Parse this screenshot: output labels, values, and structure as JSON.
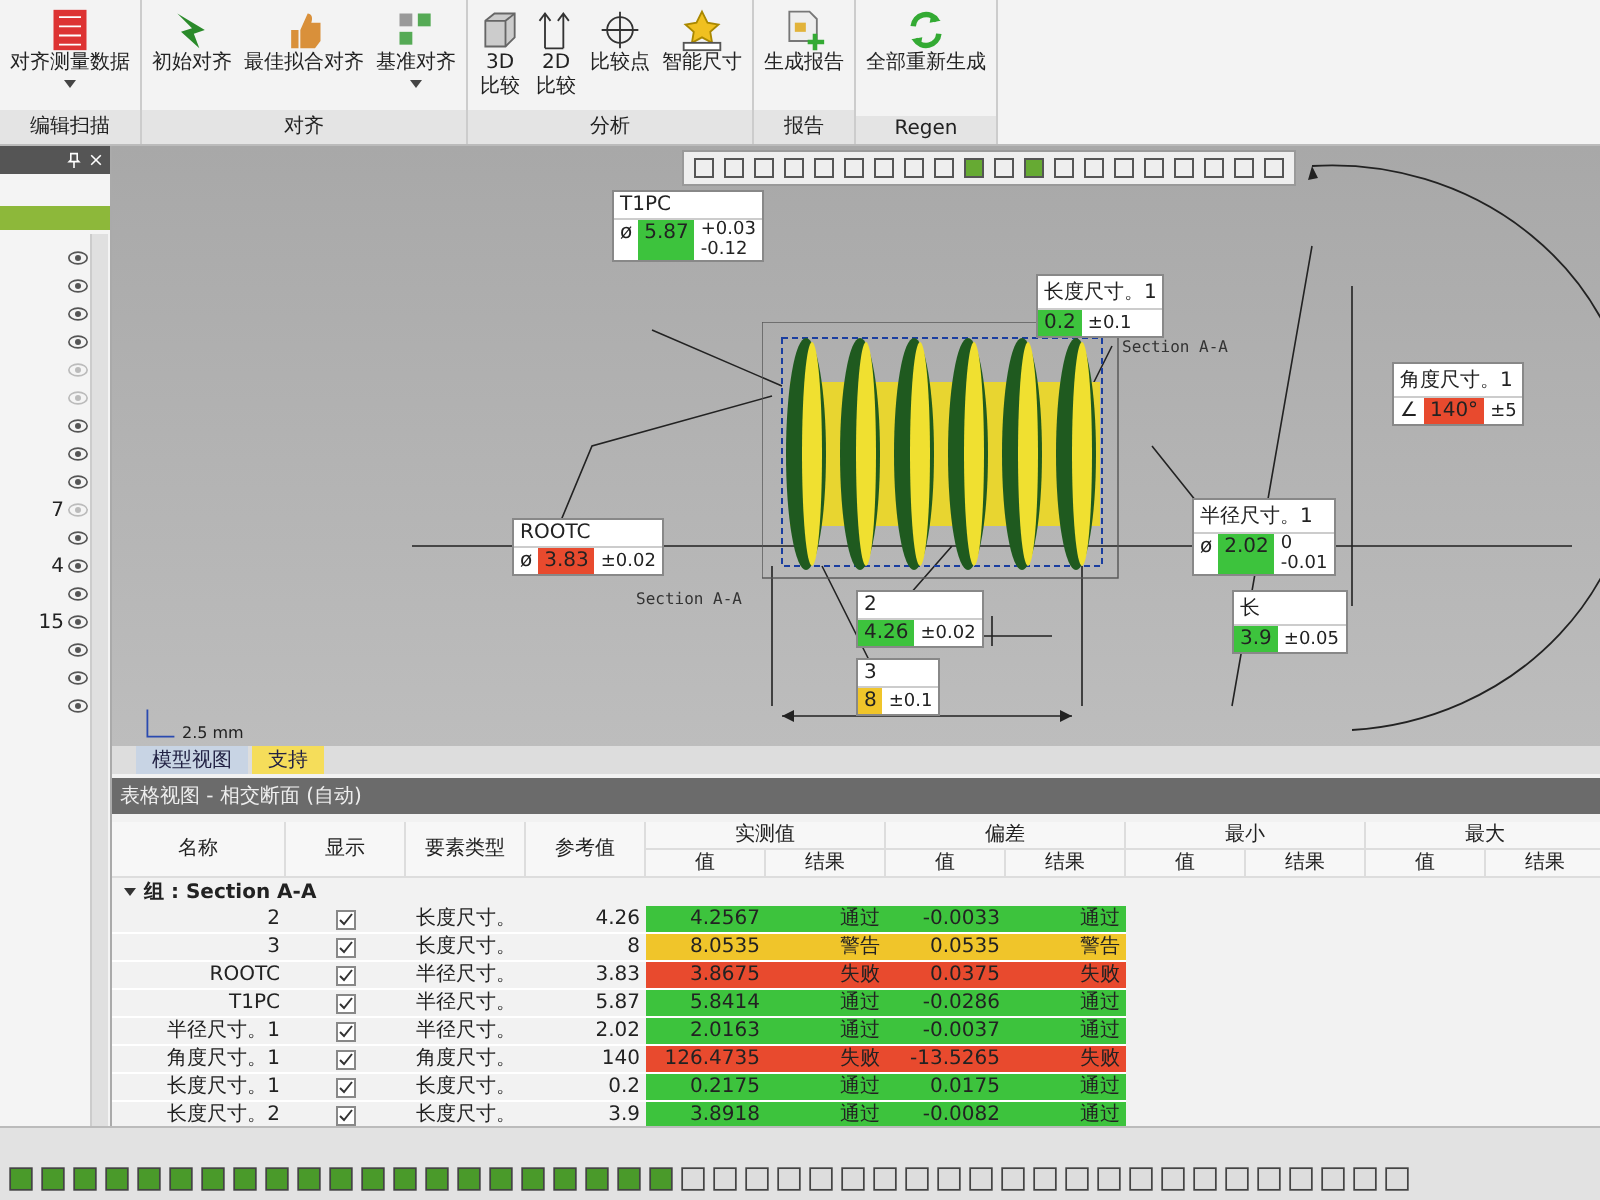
{
  "ribbon": {
    "groups": [
      {
        "label": "编辑扫描",
        "buttons": [
          {
            "label": "对齐测量数据",
            "dropdown": true
          }
        ]
      },
      {
        "label": "对齐",
        "buttons": [
          {
            "label": "初始对齐",
            "dropdown": false
          },
          {
            "label": "最佳拟合对齐",
            "dropdown": false
          },
          {
            "label": "基准对齐",
            "dropdown": true
          }
        ]
      },
      {
        "label": "分析",
        "buttons": [
          {
            "label": "3D\n比较",
            "dropdown": false
          },
          {
            "label": "2D\n比较",
            "dropdown": false
          },
          {
            "label": "比较点",
            "dropdown": false
          },
          {
            "label": "智能尺寸",
            "dropdown": false
          }
        ]
      },
      {
        "label": "报告",
        "buttons": [
          {
            "label": "生成报告",
            "dropdown": false
          }
        ]
      },
      {
        "label": "Regen",
        "buttons": [
          {
            "label": "全部重新生成",
            "dropdown": false
          }
        ]
      }
    ]
  },
  "left_panel": {
    "items": [
      {
        "visible": true
      },
      {
        "visible": true
      },
      {
        "visible": true
      },
      {
        "visible": true
      },
      {
        "visible": false
      },
      {
        "visible": false
      },
      {
        "visible": true
      },
      {
        "visible": true
      },
      {
        "visible": true
      },
      {
        "number": "7",
        "visible": false
      },
      {
        "visible": true
      },
      {
        "number": "4",
        "visible": true
      },
      {
        "visible": true
      },
      {
        "number": "15",
        "visible": true
      },
      {
        "visible": true
      },
      {
        "visible": true
      },
      {
        "visible": true
      }
    ]
  },
  "view": {
    "section_labels": [
      "Section A-A",
      "Section A-A"
    ],
    "scale": "2.5 mm",
    "annotations": [
      {
        "label": "T1PC",
        "symbol": "ø",
        "value": "5.87",
        "color": "#3dc33d",
        "tolerance": [
          "+0.03",
          "-0.12"
        ]
      },
      {
        "label": "长度尺寸。1",
        "value": "0.2",
        "color": "#3dc33d",
        "tolerance": [
          "±0.1"
        ]
      },
      {
        "label": "ROOTC",
        "symbol": "ø",
        "value": "3.83",
        "color": "#e84a2e",
        "tolerance": [
          "±0.02"
        ]
      },
      {
        "label": "2",
        "value": "4.26",
        "color": "#3dc33d",
        "tolerance": [
          "±0.02"
        ]
      },
      {
        "label": "3",
        "value": "8",
        "color": "#f0c52a",
        "tolerance": [
          "±0.1"
        ]
      },
      {
        "label": "半径尺寸。1",
        "symbol": "ø",
        "value": "2.02",
        "color": "#3dc33d",
        "tolerance": [
          "0",
          "-0.01"
        ]
      },
      {
        "label": "长",
        "value": "3.9",
        "color": "#3dc33d",
        "tolerance": [
          "±0.05"
        ]
      },
      {
        "label": "角度尺寸。1",
        "symbol": "∠",
        "value": "140°",
        "color": "#e84a2e",
        "tolerance": [
          "±5"
        ]
      }
    ]
  },
  "tabs": [
    {
      "label": "模型视图",
      "selected": false
    },
    {
      "label": "支持",
      "selected": true
    }
  ],
  "table": {
    "title": "表格视图 - 相交断面 (自动)",
    "columns": [
      "名称",
      "显示",
      "要素类型",
      "参考值"
    ],
    "column_groups": [
      {
        "label": "实测值",
        "sub": [
          "值",
          "结果"
        ]
      },
      {
        "label": "偏差",
        "sub": [
          "值",
          "结果"
        ]
      },
      {
        "label": "最小",
        "sub": [
          "值",
          "结果"
        ]
      },
      {
        "label": "最大",
        "sub": [
          "值",
          "结果"
        ]
      }
    ],
    "group": "组 : Section A-A",
    "rows": [
      {
        "name": "2",
        "shown": true,
        "type": "长度尺寸。",
        "reference": "4.26",
        "measured": "4.2567",
        "result": "通过",
        "deviation": "-0.0033",
        "deviation_result": "通过",
        "color": "#3dc33d"
      },
      {
        "name": "3",
        "shown": true,
        "type": "长度尺寸。",
        "reference": "8",
        "measured": "8.0535",
        "result": "警告",
        "deviation": "0.0535",
        "deviation_result": "警告",
        "color": "#f0c52a"
      },
      {
        "name": "ROOTC",
        "shown": true,
        "type": "半径尺寸。",
        "reference": "3.83",
        "measured": "3.8675",
        "result": "失败",
        "deviation": "0.0375",
        "deviation_result": "失败",
        "color": "#e84a2e"
      },
      {
        "name": "T1PC",
        "shown": true,
        "type": "半径尺寸。",
        "reference": "5.87",
        "measured": "5.8414",
        "result": "通过",
        "deviation": "-0.0286",
        "deviation_result": "通过",
        "color": "#3dc33d"
      },
      {
        "name": "半径尺寸。1",
        "shown": true,
        "type": "半径尺寸。",
        "reference": "2.02",
        "measured": "2.0163",
        "result": "通过",
        "deviation": "-0.0037",
        "deviation_result": "通过",
        "color": "#3dc33d"
      },
      {
        "name": "角度尺寸。1",
        "shown": true,
        "type": "角度尺寸。",
        "reference": "140",
        "measured": "126.4735",
        "result": "失败",
        "deviation": "-13.5265",
        "deviation_result": "失败",
        "color": "#e84a2e"
      },
      {
        "name": "长度尺寸。1",
        "shown": true,
        "type": "长度尺寸。",
        "reference": "0.2",
        "measured": "0.2175",
        "result": "通过",
        "deviation": "0.0175",
        "deviation_result": "通过",
        "color": "#3dc33d"
      },
      {
        "name": "长度尺寸。2",
        "shown": true,
        "type": "长度尺寸。",
        "reference": "3.9",
        "measured": "3.8918",
        "result": "通过",
        "deviation": "-0.0082",
        "deviation_result": "通过",
        "color": "#3dc33d"
      }
    ]
  }
}
